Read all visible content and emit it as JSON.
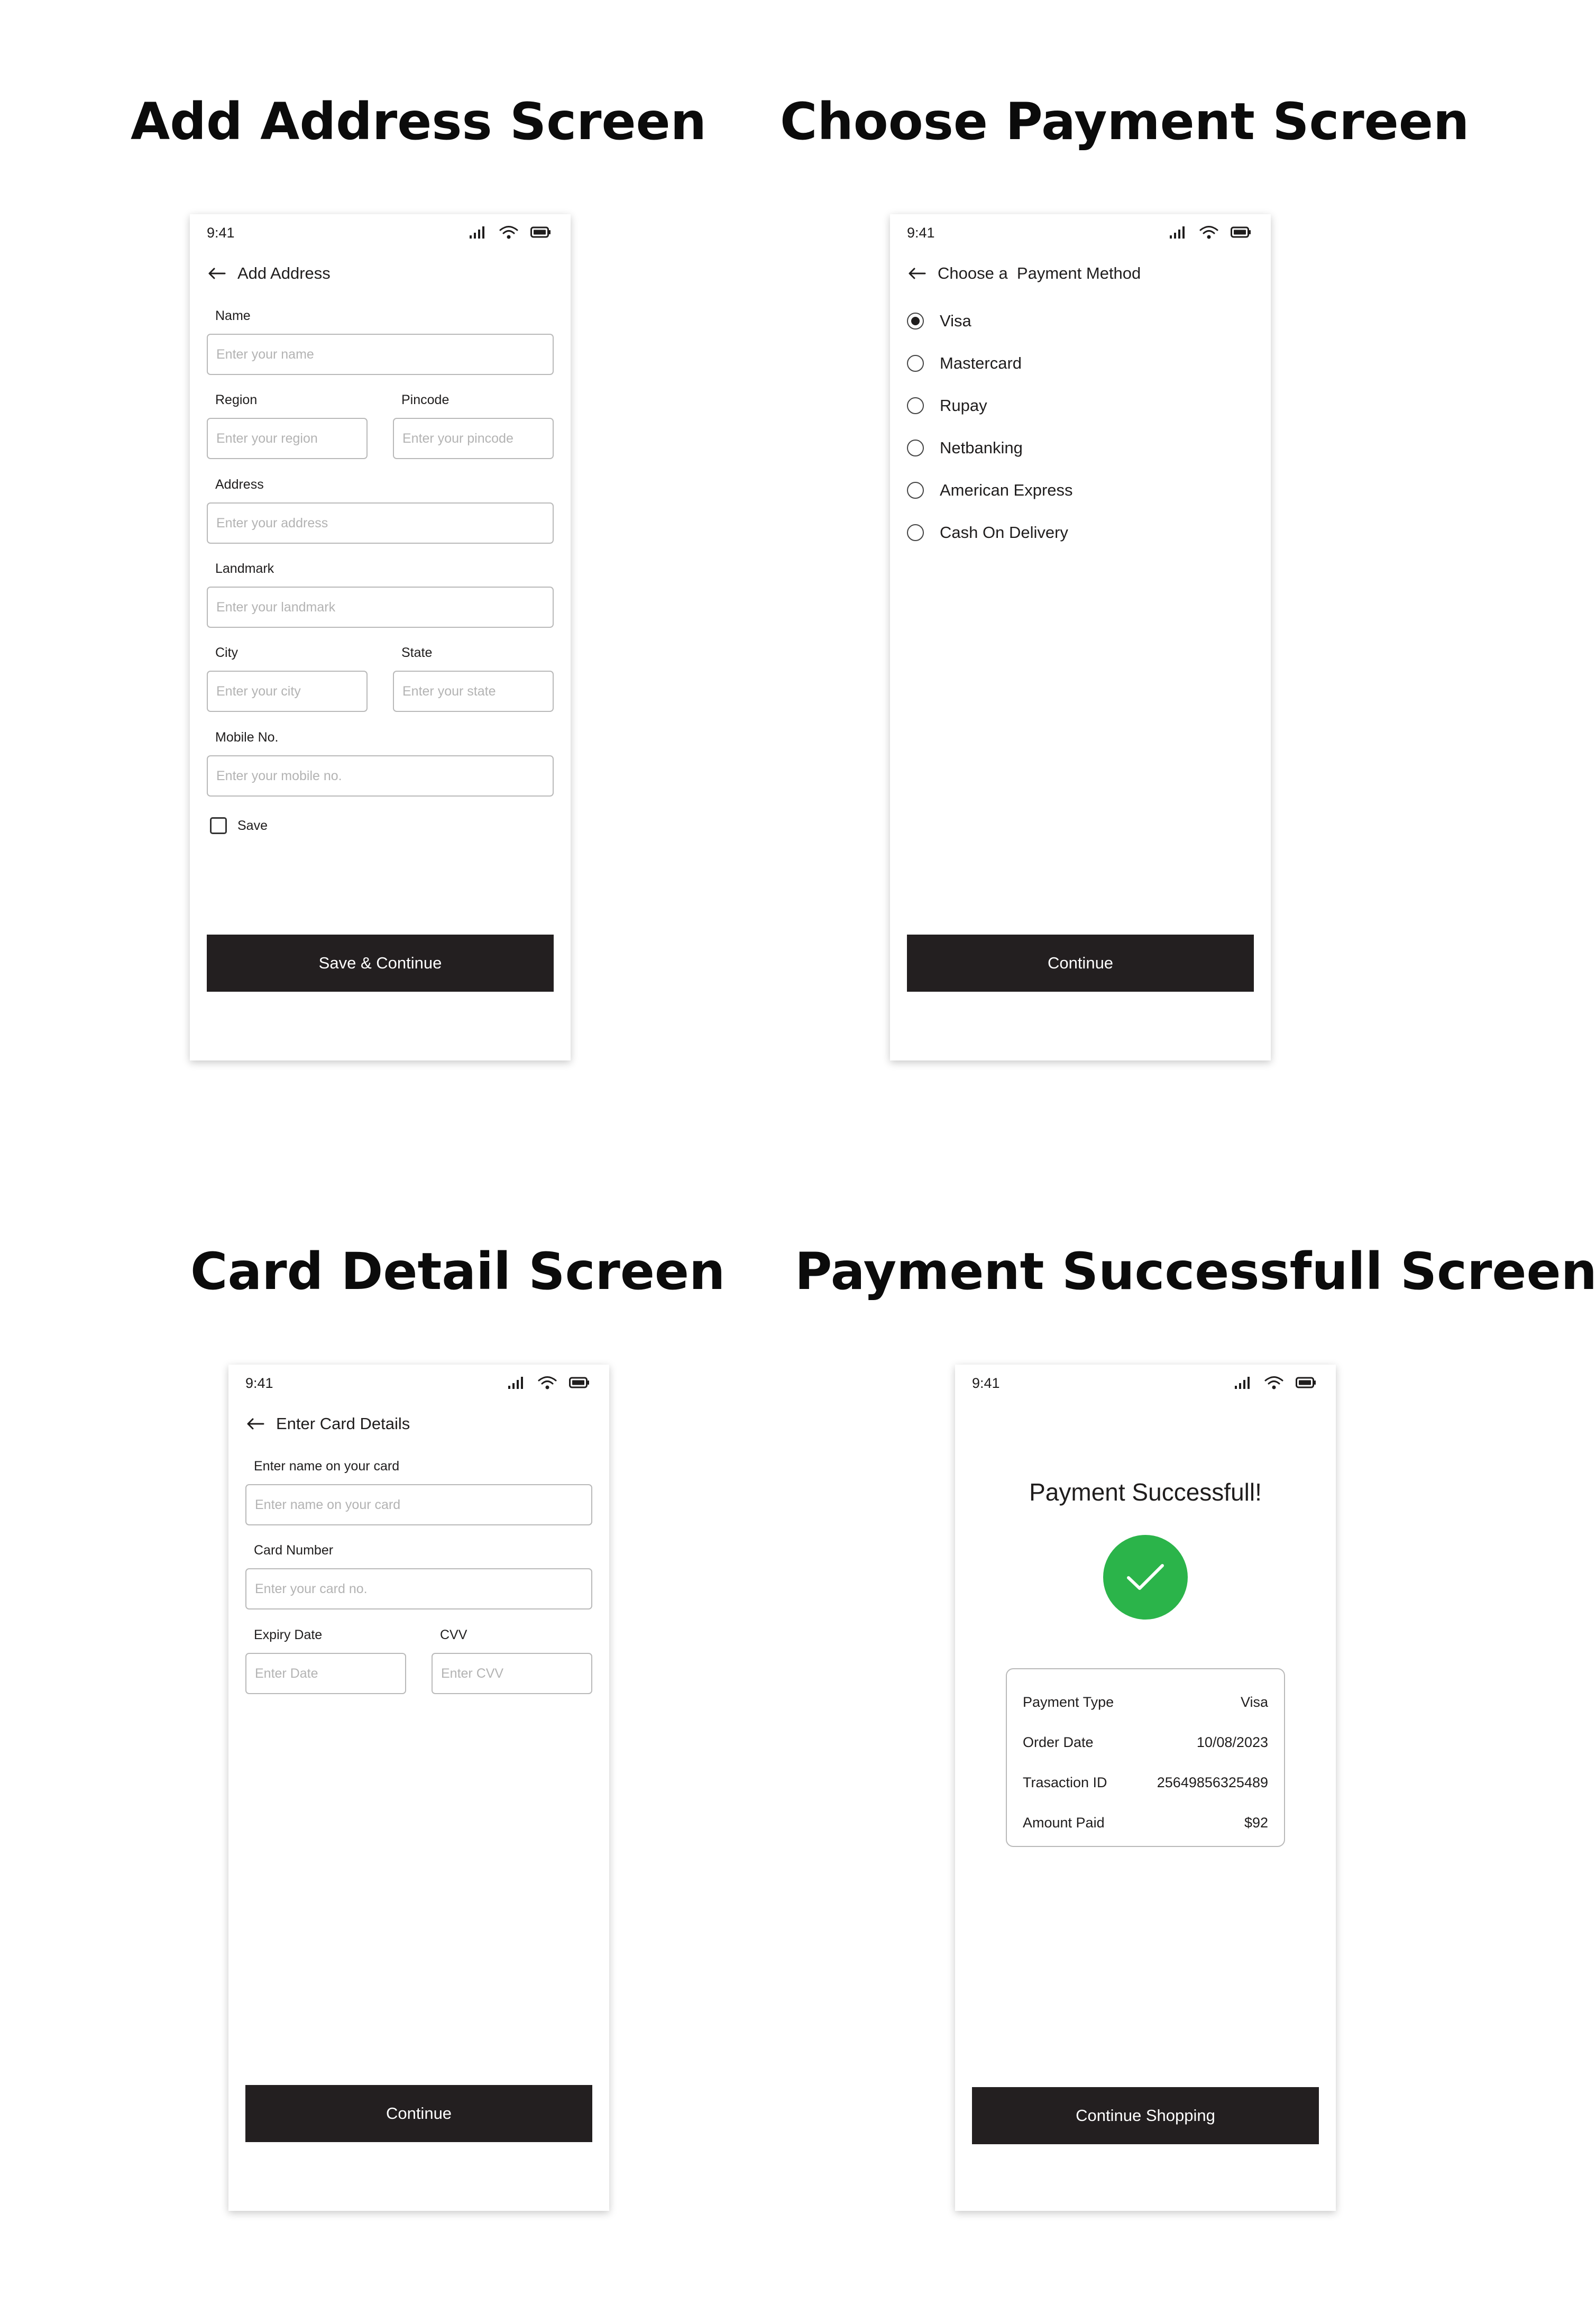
{
  "screens": {
    "add_address": {
      "section_title": "Add Address Screen",
      "status_time": "9:41",
      "header_title": "Add Address",
      "fields": {
        "name": {
          "label": "Name",
          "placeholder": "Enter your name"
        },
        "region": {
          "label": "Region",
          "placeholder": "Enter your region"
        },
        "pincode": {
          "label": "Pincode",
          "placeholder": "Enter your pincode"
        },
        "address": {
          "label": "Address",
          "placeholder": "Enter your address"
        },
        "landmark": {
          "label": "Landmark",
          "placeholder": "Enter your landmark"
        },
        "city": {
          "label": "City",
          "placeholder": "Enter your city"
        },
        "state": {
          "label": "State",
          "placeholder": "Enter your state"
        },
        "mobile": {
          "label": "Mobile No.",
          "placeholder": "Enter your mobile no."
        }
      },
      "save_checkbox_label": "Save",
      "save_checkbox_checked": false,
      "button_label": "Save & Continue"
    },
    "choose_payment": {
      "section_title": "Choose Payment Screen",
      "status_time": "9:41",
      "header_title": "Choose a  Payment Method",
      "options": [
        {
          "label": "Visa",
          "selected": true
        },
        {
          "label": "Mastercard",
          "selected": false
        },
        {
          "label": "Rupay",
          "selected": false
        },
        {
          "label": "Netbanking",
          "selected": false
        },
        {
          "label": "American Express",
          "selected": false
        },
        {
          "label": "Cash On Delivery",
          "selected": false
        }
      ],
      "button_label": "Continue"
    },
    "card_detail": {
      "section_title": "Card Detail Screen",
      "status_time": "9:41",
      "header_title": "Enter Card Details",
      "fields": {
        "card_name": {
          "label": "Enter name on your card",
          "placeholder": "Enter name on your card"
        },
        "card_number": {
          "label": "Card Number",
          "placeholder": "Enter your card no."
        },
        "expiry": {
          "label": "Expiry Date",
          "placeholder": "Enter Date"
        },
        "cvv": {
          "label": "CVV",
          "placeholder": "Enter CVV"
        }
      },
      "button_label": "Continue"
    },
    "payment_success": {
      "section_title": "Payment Successfull Screen",
      "status_time": "9:41",
      "title": "Payment Successfull!",
      "details": [
        {
          "label": "Payment Type",
          "value": "Visa"
        },
        {
          "label": "Order Date",
          "value": "10/08/2023"
        },
        {
          "label": "Trasaction ID",
          "value": "25649856325489"
        },
        {
          "label": "Amount Paid",
          "value": "$92"
        }
      ],
      "button_label": "Continue Shopping"
    }
  },
  "icons": {
    "status": [
      "signal-icon",
      "wifi-icon",
      "battery-icon"
    ],
    "back": "back-arrow-icon",
    "success": "checkmark-icon"
  },
  "colors": {
    "button_bg": "#231f20",
    "button_text": "#ffffff",
    "input_border": "#b9b9b9",
    "placeholder": "#b3b3b3",
    "success_green": "#2bb44a",
    "text": "#1f1d1d"
  }
}
